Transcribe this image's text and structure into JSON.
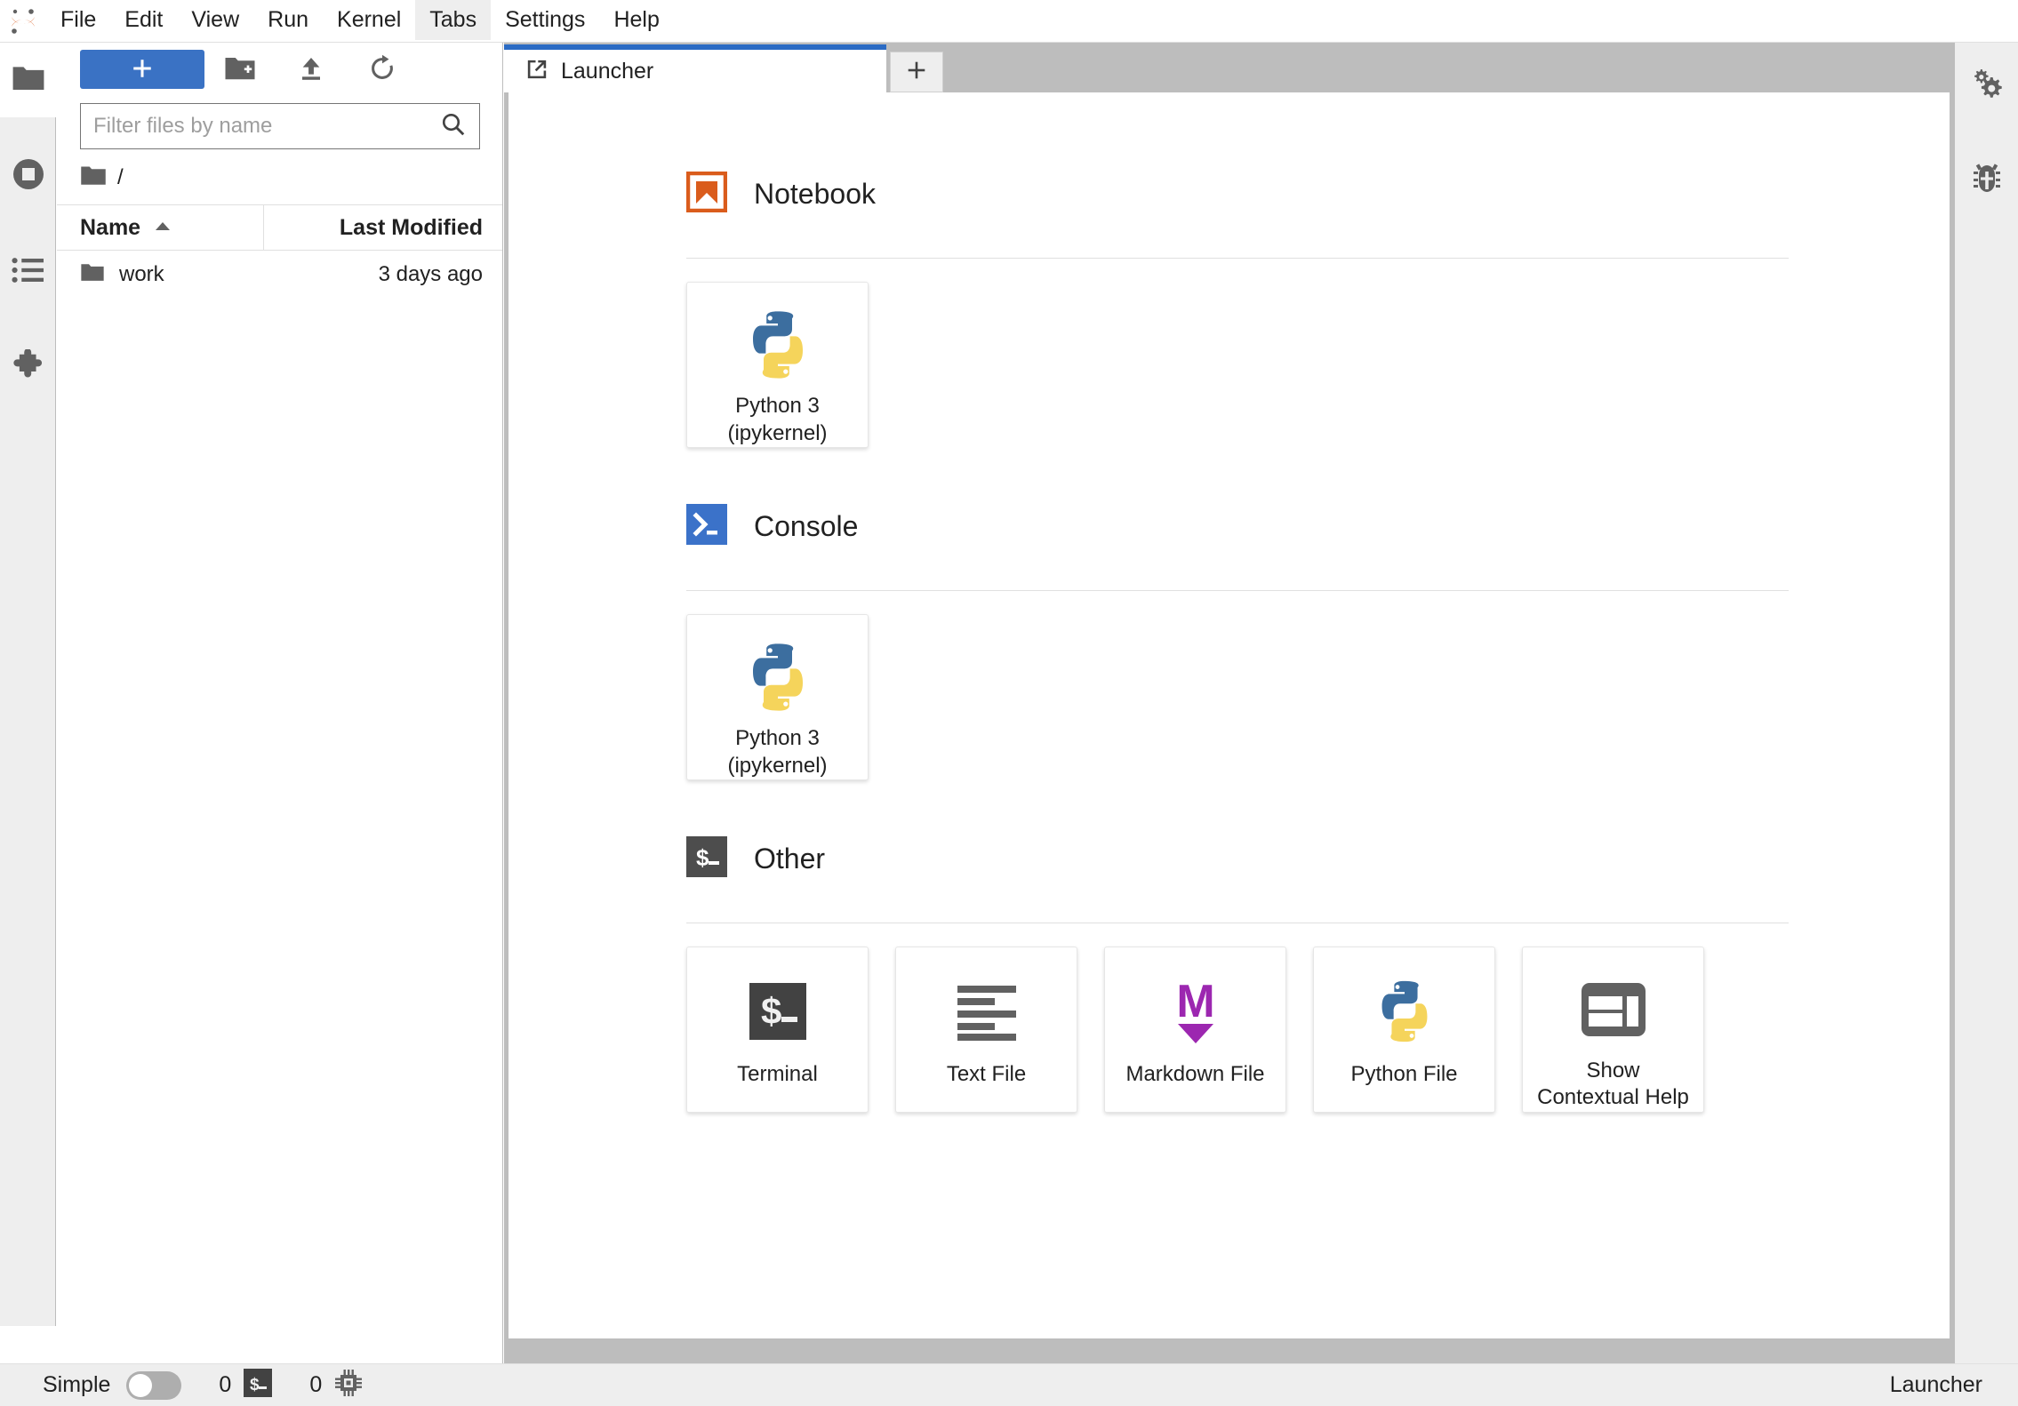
{
  "window": {
    "title": "JupyterLab"
  },
  "menubar": {
    "logo_name": "jupyter-logo",
    "items": [
      {
        "label": "File",
        "active": false
      },
      {
        "label": "Edit",
        "active": false
      },
      {
        "label": "View",
        "active": false
      },
      {
        "label": "Run",
        "active": false
      },
      {
        "label": "Kernel",
        "active": false
      },
      {
        "label": "Tabs",
        "active": true
      },
      {
        "label": "Settings",
        "active": false
      },
      {
        "label": "Help",
        "active": false
      }
    ]
  },
  "left_activity_bar": {
    "items": [
      {
        "name": "file-browser",
        "icon": "folder-icon",
        "selected": true
      },
      {
        "name": "running",
        "icon": "stop-circle-icon",
        "selected": false
      },
      {
        "name": "commands",
        "icon": "list-icon",
        "selected": false
      },
      {
        "name": "extensions",
        "icon": "puzzle-piece-icon",
        "selected": false
      }
    ]
  },
  "file_browser": {
    "toolbar": {
      "new_launcher_label": "+",
      "new_folder_icon": "new-folder-icon",
      "upload_icon": "upload-icon",
      "refresh_icon": "refresh-icon"
    },
    "filter": {
      "value": "",
      "placeholder": "Filter files by name",
      "search_icon": "search-icon"
    },
    "breadcrumb": {
      "root_icon": "folder-icon",
      "path": "/"
    },
    "columns": [
      {
        "label": "Name",
        "sorted": true,
        "sort_icon": "caret-up-icon"
      },
      {
        "label": "Last Modified",
        "sorted": false
      }
    ],
    "rows": [
      {
        "icon": "folder-icon",
        "name": "work",
        "last_modified": "3 days ago"
      }
    ]
  },
  "dock": {
    "tabs": [
      {
        "label": "Launcher",
        "icon": "launcher-icon",
        "active": true
      }
    ],
    "add_tab_label": "+"
  },
  "launcher": {
    "sections": [
      {
        "key": "notebook",
        "title": "Notebook",
        "icon": "notebook-bookmark-icon",
        "icon_color": "#da5c1c",
        "cards": [
          {
            "label": "Python 3\n(ipykernel)",
            "icon": "python-logo-icon"
          }
        ]
      },
      {
        "key": "console",
        "title": "Console",
        "icon": "console-prompt-icon",
        "icon_color": "#3b72c9",
        "cards": [
          {
            "label": "Python 3\n(ipykernel)",
            "icon": "python-logo-icon"
          }
        ]
      },
      {
        "key": "other",
        "title": "Other",
        "icon": "terminal-prompt-icon",
        "icon_color": "#4d4d4d",
        "cards": [
          {
            "label": "Terminal",
            "icon": "terminal-icon"
          },
          {
            "label": "Text File",
            "icon": "text-file-icon"
          },
          {
            "label": "Markdown File",
            "icon": "markdown-icon"
          },
          {
            "label": "Python File",
            "icon": "python-logo-icon"
          },
          {
            "label": "Show\nContextual Help",
            "icon": "inspector-icon"
          }
        ]
      }
    ]
  },
  "right_activity_bar": {
    "items": [
      {
        "name": "property-inspector",
        "icon": "gears-icon"
      },
      {
        "name": "debugger",
        "icon": "bug-icon"
      }
    ]
  },
  "statusbar": {
    "mode_label": "Simple",
    "mode_on": false,
    "terminal_count": "0",
    "terminal_icon": "terminal-icon",
    "kernel_count": "0",
    "kernel_icon": "kernel-chip-icon",
    "current_view": "Launcher"
  },
  "colors": {
    "accent_blue": "#3a72c4",
    "tab_active_border": "#2b6bc4",
    "notebook_orange": "#da5c1c",
    "console_blue": "#3b72c9",
    "markdown_purple": "#9c27b0",
    "terminal_dark": "#4d4d4d",
    "python_blue": "#3c6e9f",
    "python_yellow": "#f5d45b",
    "dock_bg": "#bdbdbd",
    "panel_bg": "#eeeeee"
  }
}
